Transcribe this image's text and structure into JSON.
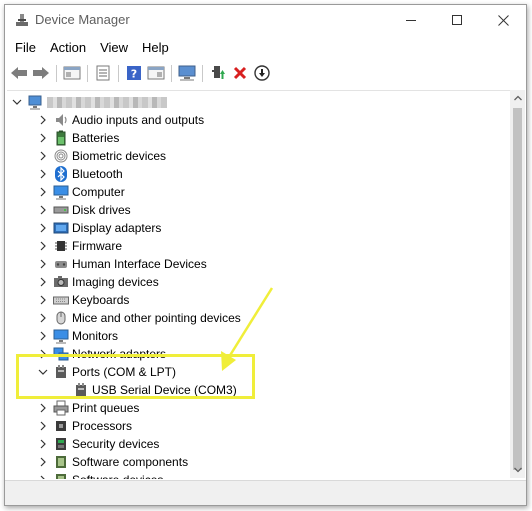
{
  "window": {
    "title": "Device Manager",
    "controls": [
      "minimize",
      "maximize",
      "close"
    ]
  },
  "menu": {
    "items": [
      "File",
      "Action",
      "View",
      "Help"
    ]
  },
  "toolbar": {
    "buttons": [
      "back-icon",
      "forward-icon",
      "show-hide-console-tree-icon",
      "properties-icon",
      "help-icon",
      "action-pane-icon",
      "scan-hardware-icon",
      "update-driver-icon",
      "uninstall-device-icon",
      "disable-device-icon"
    ]
  },
  "tree": {
    "computer_name_redacted": true,
    "categories": [
      {
        "label": "Audio inputs and outputs",
        "icon": "speaker-icon"
      },
      {
        "label": "Batteries",
        "icon": "battery-icon"
      },
      {
        "label": "Biometric devices",
        "icon": "fingerprint-icon"
      },
      {
        "label": "Bluetooth",
        "icon": "bluetooth-icon"
      },
      {
        "label": "Computer",
        "icon": "monitor-icon"
      },
      {
        "label": "Disk drives",
        "icon": "disk-drive-icon"
      },
      {
        "label": "Display adapters",
        "icon": "display-adapter-icon"
      },
      {
        "label": "Firmware",
        "icon": "chip-icon"
      },
      {
        "label": "Human Interface Devices",
        "icon": "hid-icon"
      },
      {
        "label": "Imaging devices",
        "icon": "camera-icon"
      },
      {
        "label": "Keyboards",
        "icon": "keyboard-icon"
      },
      {
        "label": "Mice and other pointing devices",
        "icon": "mouse-icon"
      },
      {
        "label": "Monitors",
        "icon": "monitor-icon"
      },
      {
        "label": "Network adapters",
        "icon": "network-icon"
      },
      {
        "label": "Ports (COM & LPT)",
        "icon": "port-icon",
        "expanded": true,
        "children": [
          {
            "label": "USB Serial Device (COM3)",
            "icon": "port-icon"
          }
        ]
      },
      {
        "label": "Print queues",
        "icon": "printer-icon"
      },
      {
        "label": "Processors",
        "icon": "processor-icon"
      },
      {
        "label": "Security devices",
        "icon": "security-icon"
      },
      {
        "label": "Software components",
        "icon": "software-icon"
      },
      {
        "label": "Software devices",
        "icon": "software-icon"
      }
    ]
  },
  "annotation": {
    "highlight_color": "#f0ee3a",
    "target": "Ports (COM & LPT)"
  }
}
